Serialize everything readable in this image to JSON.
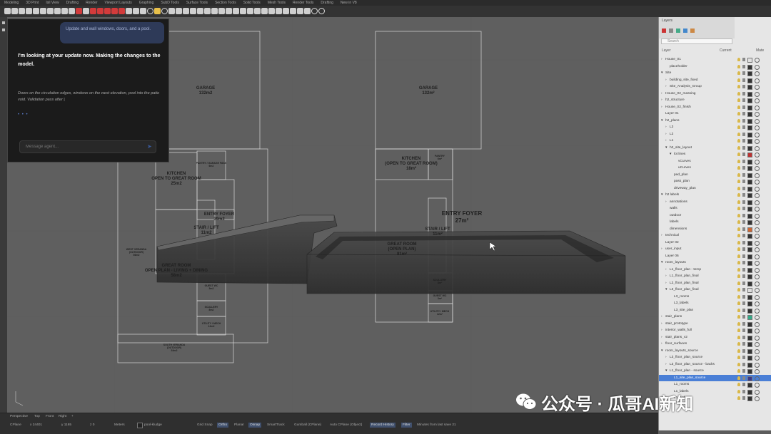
{
  "menubar": [
    "Modeling",
    "3D Print",
    "Isil View",
    "Drafting",
    "Render",
    "Viewport Layouts",
    "Graphing",
    "SubD Tools",
    "Surface Tools",
    "Section Tools",
    "Solid Tools",
    "Mesh Tools",
    "Render Tools",
    "Drafting",
    "New in V8"
  ],
  "chat": {
    "user_message": "Update and wall windows, doors, and a pool.",
    "response": "I'm looking at your update now. Making the changes to the model.",
    "status": "Doors on the circulation edges, windows on the west elevation, pool into the patio void. Validation pass after |",
    "dots": "• • •",
    "input_placeholder": "Message agent..."
  },
  "plan_left": {
    "garage": "GARAGE\n132m2",
    "pantry": "PANTRY / GARAGE PASS\n6m2",
    "kitchen": "KITCHEN\nOPEN TO GREAT ROOM\n25m2",
    "entry": "ENTRY FOYER\n39m2",
    "stair": "STAIR / LIFT\n11m2",
    "veranda": "WEST VERANDA\n(OUTDOOR)\n56m2",
    "great": "GREAT ROOM\nOPEN PLAN - LIVING + DINING\n58m2",
    "guest": "GUEST WC\n3m2",
    "scull": "SCULLERY\n8m2",
    "utility": "UTILITY / MECH\n12m2",
    "south": "SOUTH VERANDA\n(OUTDOOR)\n34m2"
  },
  "plan_right": {
    "garage": "GARAGE\n132m²",
    "pantry": "PANTRY\n6m²",
    "kitchen": "KITCHEN\n(OPEN TO GREAT ROOM)\n18m²",
    "entry": "ENTRY FOYER\n27m²",
    "stair": "STAIR / LIFT\n11m²",
    "great": "GREAT ROOM\n(OPEN PLAN)\n81m²",
    "scull": "SCULLERY\n8m²",
    "guest": "GUEST WC\n3m²",
    "utility": "UTILITY / MECH\n12m²"
  },
  "layer_panel": {
    "title": "Layers",
    "search_placeholder": "Search",
    "col_layer": "Layer",
    "col_current": "Current",
    "col_mat": "Mate",
    "layers": [
      {
        "name": "House_01",
        "indent": 0,
        "arrow": "›"
      },
      {
        "name": "placeholder",
        "indent": 1,
        "arrow": ""
      },
      {
        "name": "Site",
        "indent": 0,
        "arrow": "▾"
      },
      {
        "name": "building_site_fixed",
        "indent": 1,
        "arrow": "›"
      },
      {
        "name": "Site_Analysis_Group",
        "indent": 1,
        "arrow": "›"
      },
      {
        "name": "House_02_massing",
        "indent": 0,
        "arrow": "›"
      },
      {
        "name": "h2_structure",
        "indent": 0,
        "arrow": "›"
      },
      {
        "name": "House_02_finish",
        "indent": 0,
        "arrow": "›"
      },
      {
        "name": "Layer 01",
        "indent": 0,
        "arrow": ""
      },
      {
        "name": "h2_plans",
        "indent": 0,
        "arrow": "▾"
      },
      {
        "name": "L3",
        "indent": 1,
        "arrow": "›"
      },
      {
        "name": "L2",
        "indent": 1,
        "arrow": "›"
      },
      {
        "name": "L1",
        "indent": 1,
        "arrow": "›"
      },
      {
        "name": "h2_site_layout",
        "indent": 1,
        "arrow": "▾"
      },
      {
        "name": "lot lines",
        "indent": 2,
        "arrow": "▾"
      },
      {
        "name": "vCurves",
        "indent": 3,
        "arrow": ""
      },
      {
        "name": "uCurves",
        "indent": 3,
        "arrow": ""
      },
      {
        "name": "pad_plan",
        "indent": 2,
        "arrow": ""
      },
      {
        "name": "pass_plan",
        "indent": 2,
        "arrow": ""
      },
      {
        "name": "driveway_plan",
        "indent": 2,
        "arrow": ""
      },
      {
        "name": "h2 labels",
        "indent": 0,
        "arrow": "▾"
      },
      {
        "name": "annotations",
        "indent": 1,
        "arrow": "›"
      },
      {
        "name": "walls",
        "indent": 1,
        "arrow": ""
      },
      {
        "name": "outdoor",
        "indent": 1,
        "arrow": ""
      },
      {
        "name": "labels",
        "indent": 1,
        "arrow": ""
      },
      {
        "name": "dimensions",
        "indent": 1,
        "arrow": ""
      },
      {
        "name": "technical",
        "indent": 0,
        "arrow": "›"
      },
      {
        "name": "Layer 02",
        "indent": 0,
        "arrow": ""
      },
      {
        "name": "user_input",
        "indent": 0,
        "arrow": "›"
      },
      {
        "name": "Layer 06",
        "indent": 0,
        "arrow": ""
      },
      {
        "name": "room_layouts",
        "indent": 0,
        "arrow": "▾"
      },
      {
        "name": "L1_floor_plan - temp",
        "indent": 1,
        "arrow": "›"
      },
      {
        "name": "L1_floor_plan_final",
        "indent": 1,
        "arrow": "›"
      },
      {
        "name": "L2_floor_plan_final",
        "indent": 1,
        "arrow": "›"
      },
      {
        "name": "L3_floor_plan_final",
        "indent": 1,
        "arrow": "▾"
      },
      {
        "name": "L3_rooms",
        "indent": 2,
        "arrow": ""
      },
      {
        "name": "L3_labels",
        "indent": 2,
        "arrow": ""
      },
      {
        "name": "L3_site_plan",
        "indent": 2,
        "arrow": ""
      },
      {
        "name": "stair_plans",
        "indent": 0,
        "arrow": "›"
      },
      {
        "name": "stair_prototype",
        "indent": 0,
        "arrow": "›"
      },
      {
        "name": "interior_walls_full",
        "indent": 0,
        "arrow": "›"
      },
      {
        "name": "stair_plans_v2",
        "indent": 0,
        "arrow": "›"
      },
      {
        "name": "floor_surfaces",
        "indent": 0,
        "arrow": "›"
      },
      {
        "name": "room_layouts_source",
        "indent": 0,
        "arrow": "▾"
      },
      {
        "name": "L3_floor_plan_source",
        "indent": 1,
        "arrow": "›"
      },
      {
        "name": "L3_floor_plan_source - backs",
        "indent": 1,
        "arrow": "›"
      },
      {
        "name": "L1_floor_plan - source",
        "indent": 1,
        "arrow": "▾"
      },
      {
        "name": "L1_site_plan_source",
        "indent": 2,
        "arrow": "",
        "selected": true
      },
      {
        "name": "L1_rooms",
        "indent": 2,
        "arrow": ""
      },
      {
        "name": "L1_labels",
        "indent": 2,
        "arrow": ""
      },
      {
        "name": "L1_walls",
        "indent": 2,
        "arrow": ""
      }
    ]
  },
  "statusbar": {
    "viewport_name": "Perspective",
    "tabs": [
      "Top",
      "Front",
      "Right",
      "+"
    ],
    "cplane": "CPlane",
    "x": "x 24401",
    "y": "y 1165",
    "z": "z 0",
    "units": "Meters",
    "layer": "pool-kludge",
    "grid_snap": "Grid Snap",
    "ortho": "Ortho",
    "planar": "Planar",
    "osnap": "Osnap",
    "smarttrack": "SmartTrack",
    "gumball": "Gumball (CPlane)",
    "autocplane": "Auto CPlane (Object)",
    "record_history": "Record History",
    "filter": "Filter",
    "memo": "Minutes from last save 21"
  },
  "watermark": {
    "text": "公众号 · 瓜哥AI新知"
  }
}
